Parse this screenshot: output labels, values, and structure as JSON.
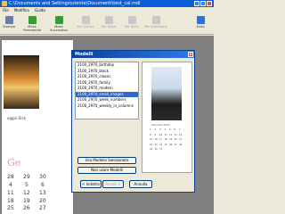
{
  "window": {
    "title": "C:\\Documents and Settings\\utente\\Documenti\\test_cal.mdi",
    "menu": [
      "File",
      "Modifica",
      "Guida"
    ]
  },
  "toolbar": {
    "buttons": [
      {
        "label": "Stampa",
        "icon": "printer-icon"
      },
      {
        "label": "Mese Precedente",
        "icon": "arrow-left-icon"
      },
      {
        "label": "Mese Successivo",
        "icon": "arrow-right-icon"
      },
      {
        "label": "Per Giorno",
        "icon": "day-view-icon"
      },
      {
        "label": "Per Mese",
        "icon": "month-view-icon"
      },
      {
        "label": "Per Anno",
        "icon": "year-view-icon"
      },
      {
        "label": "Per Settimana",
        "icon": "week-view-icon"
      },
      {
        "label": "Aiuto",
        "icon": "help-icon"
      }
    ]
  },
  "background": {
    "caption": "oggio Dick",
    "month": "Ge",
    "calendar": [
      "28",
      "29",
      "30",
      "4",
      "5",
      "6",
      "11",
      "12",
      "13",
      "18",
      "19",
      "20",
      "25",
      "26",
      "27"
    ]
  },
  "dialog": {
    "title": "Modelli",
    "close": "x",
    "templates": [
      "2100_2970_birthday",
      "2100_2970_black",
      "2100_2970_classic",
      "2100_2970_family",
      "2100_2970_modern",
      "2100_2970_small_images",
      "2100_2970_week_numbers",
      "2100_2970_weekly_in_columns"
    ],
    "selected_index": 5,
    "preview": {
      "month": "Gennaio 2007",
      "days": [
        "1",
        "2",
        "3",
        "4",
        "5",
        "6",
        "7",
        "8",
        "9",
        "10",
        "11",
        "12",
        "13",
        "14",
        "15",
        "16",
        "17",
        "18",
        "19",
        "20",
        "21",
        "22",
        "23",
        "24",
        "25",
        "26",
        "27",
        "28",
        "29",
        "30",
        "31"
      ]
    },
    "buttons": {
      "use": "Usa Modello Selezionato",
      "none": "Non usare Modelli",
      "back": "< Indietro",
      "next": "Avanti >",
      "cancel": "Annulla"
    }
  }
}
